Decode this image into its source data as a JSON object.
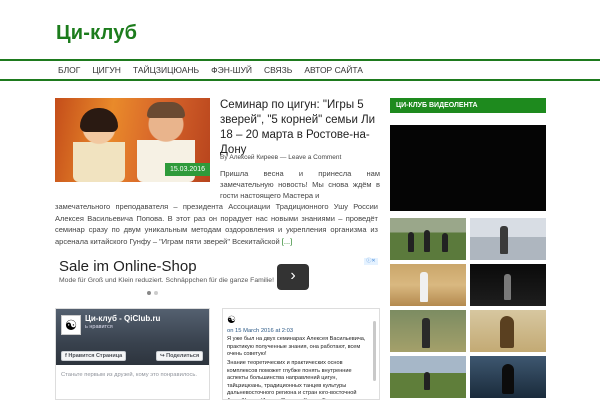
{
  "site": {
    "title": "Ци-клуб"
  },
  "nav": {
    "items": [
      {
        "label": "БЛОГ"
      },
      {
        "label": "ЦИГУН"
      },
      {
        "label": "ТАЙЦЗИЦЮАНЬ"
      },
      {
        "label": "ФЭН-ШУЙ"
      },
      {
        "label": "СВЯЗЬ"
      },
      {
        "label": "АВТОР САЙТА"
      }
    ]
  },
  "post": {
    "title": "Семинар по цигун: \"Игры 5 зверей\", \"5 корней\" семьи Ли 18 – 20 марта в Ростове-на-Дону",
    "date_badge": "15.03.2016",
    "meta_by": "By",
    "author": "Алексей Киреев",
    "meta_sep": "—",
    "comment_link": "Leave a Comment",
    "excerpt_right": "Пришла весна и принесла нам замечательную новость! Мы снова ждём в гости настоящего Мастера и",
    "excerpt_full": "замечательного преподавателя – президента Ассоциации Традиционного Ушу России Алексея Васильевича Попова. В этот раз он порадует нас новыми знаниями – проведёт семинар сразу по двум уникальным методам оздоровления и укрепления организма из арсенала китайского Гунфу – \"Играм пяти зверей\" Всекитайской",
    "read_more": "[...]"
  },
  "ad": {
    "title": "Sale im Online-Shop",
    "description": "Mode für Groß und Klein reduziert. Schnäppchen für die ganze Familie!",
    "arrow": "›",
    "info": "ⓘ✕"
  },
  "facebook": {
    "logo": "☯",
    "page_name": "Ци-клуб - QiClub.ru",
    "likes": "ь нравится",
    "like_button": "Нравится Страница",
    "share_button": "Поделиться",
    "friends_text": "Станьте первым из друзей, кому это понравилось."
  },
  "vk": {
    "symbol": "☯",
    "date": "on 15 March 2016 at 2:03",
    "paragraph1": "Я уже был на двух семинарах Алексея Васильевича, практикую полученные знания, она работают, всем очень советую!",
    "paragraph2": "Знание теоретических и практических основ комплексов поможет глубже понять внутренние аспекты большинства направлений цигун, тайцзицюань, традиционных танцев культуры дальневосточного региона и стран юго-восточной Азии (Китая, Индии, Японии, Кореи, Бирмы и Вьетнама), традиционных"
  },
  "sidebar": {
    "widget_title": "ЦИ-КЛУБ ВИДЕОЛЕНТА"
  }
}
